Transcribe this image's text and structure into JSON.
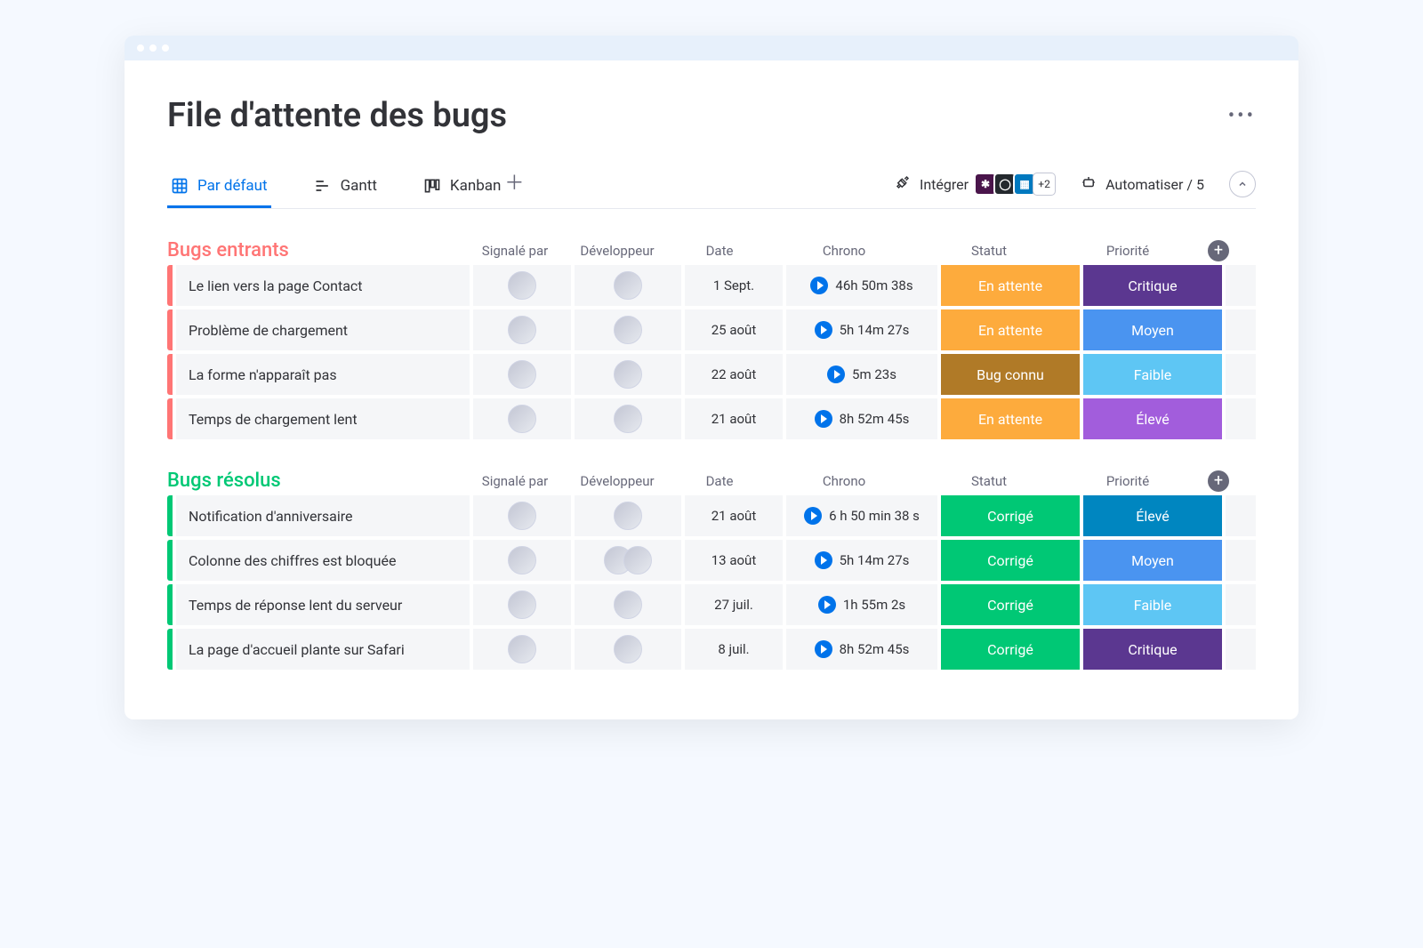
{
  "page": {
    "title": "File d'attente des bugs"
  },
  "tabs": [
    {
      "label": "Par défaut",
      "icon": "grid",
      "active": true
    },
    {
      "label": "Gantt",
      "icon": "gantt",
      "active": false
    },
    {
      "label": "Kanban",
      "icon": "kanban",
      "active": false
    }
  ],
  "toolbar": {
    "integrate_label": "Intégrer",
    "integrate_more": "+2",
    "automate_label": "Automatiser / 5"
  },
  "columns": {
    "reported": "Signalé par",
    "developer": "Développeur",
    "date": "Date",
    "chrono": "Chrono",
    "status": "Statut",
    "priority": "Priorité"
  },
  "groups": [
    {
      "id": "incoming",
      "title": "Bugs entrants",
      "color": "#ff7575",
      "rows": [
        {
          "name": "Le lien vers la page Contact",
          "date": "1 Sept.",
          "chrono": "46h 50m 38s",
          "status": "En attente",
          "status_color": "#fdab3d",
          "priority": "Critique",
          "priority_color": "#5b3790",
          "dev_pair": false
        },
        {
          "name": "Problème de chargement",
          "date": "25 août",
          "chrono": "5h 14m 27s",
          "status": "En attente",
          "status_color": "#fdab3d",
          "priority": "Moyen",
          "priority_color": "#4a94f0",
          "dev_pair": false
        },
        {
          "name": "La forme n'apparaît pas",
          "date": "22 août",
          "chrono": "5m 23s",
          "status": "Bug connu",
          "status_color": "#b07a27",
          "priority": "Faible",
          "priority_color": "#5ec6f4",
          "dev_pair": false
        },
        {
          "name": "Temps de chargement lent",
          "date": "21 août",
          "chrono": "8h 52m 45s",
          "status": "En attente",
          "status_color": "#fdab3d",
          "priority": "Élevé",
          "priority_color": "#a25ddc",
          "dev_pair": false
        }
      ]
    },
    {
      "id": "resolved",
      "title": "Bugs résolus",
      "color": "#00c875",
      "rows": [
        {
          "name": "Notification d'anniversaire",
          "date": "21 août",
          "chrono": "6 h 50 min 38 s",
          "status": "Corrigé",
          "status_color": "#00c875",
          "priority": "Élevé",
          "priority_color": "#0086c0",
          "dev_pair": false
        },
        {
          "name": "Colonne des chiffres est bloquée",
          "date": "13 août",
          "chrono": "5h 14m 27s",
          "status": "Corrigé",
          "status_color": "#00c875",
          "priority": "Moyen",
          "priority_color": "#4a94f0",
          "dev_pair": true
        },
        {
          "name": "Temps de réponse lent du serveur",
          "date": "27 juil.",
          "chrono": "1h 55m 2s",
          "status": "Corrigé",
          "status_color": "#00c875",
          "priority": "Faible",
          "priority_color": "#5ec6f4",
          "dev_pair": false
        },
        {
          "name": "La page d'accueil plante sur Safari",
          "date": "8 juil.",
          "chrono": "8h 52m 45s",
          "status": "Corrigé",
          "status_color": "#00c875",
          "priority": "Critique",
          "priority_color": "#5b3790",
          "dev_pair": false
        }
      ]
    }
  ]
}
